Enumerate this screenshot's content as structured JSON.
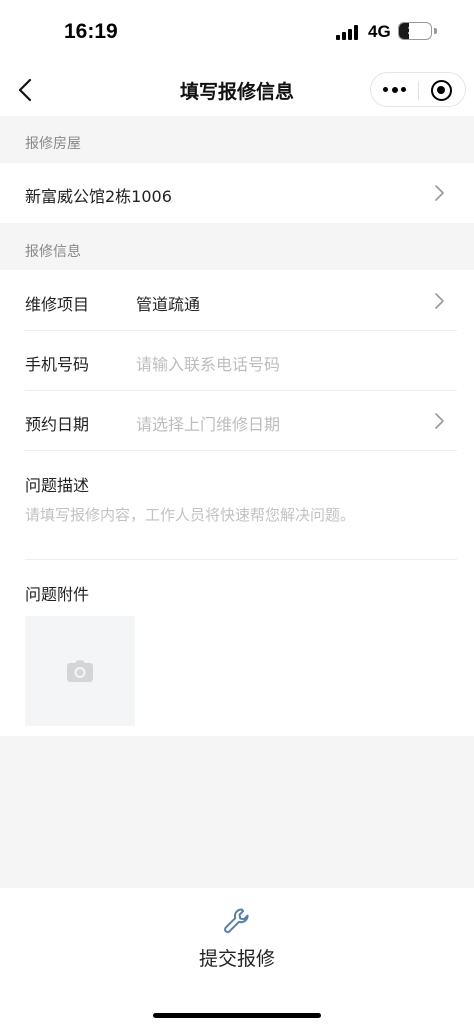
{
  "status_bar": {
    "time": "16:19",
    "network": "4G",
    "battery_level": "30",
    "battery_fraction": 0.3
  },
  "nav": {
    "title": "填写报修信息",
    "icons": [
      "back-icon",
      "more-icon",
      "target-icon"
    ]
  },
  "house_section": {
    "label": "报修房屋",
    "value": "新富威公馆2栋1006"
  },
  "info_section": {
    "label": "报修信息",
    "fields": [
      {
        "label": "维修项目",
        "value": "管道疏通",
        "placeholder": ""
      },
      {
        "label": "手机号码",
        "value": "",
        "placeholder": "请输入联系电话号码"
      },
      {
        "label": "预约日期",
        "value": "",
        "placeholder": "请选择上门维修日期"
      }
    ]
  },
  "description": {
    "label": "问题描述",
    "placeholder": "请填写报修内容，工作人员将快速帮您解决问题。"
  },
  "attachment": {
    "label": "问题附件",
    "icon": "camera-icon"
  },
  "bottom": {
    "submit_label": "提交报修",
    "icon": "wrench-icon"
  },
  "colors": {
    "background": "#f5f5f5",
    "placeholder": "#bdbdbd",
    "section_label": "#888888",
    "icon_accent": "#5a7fa8"
  }
}
